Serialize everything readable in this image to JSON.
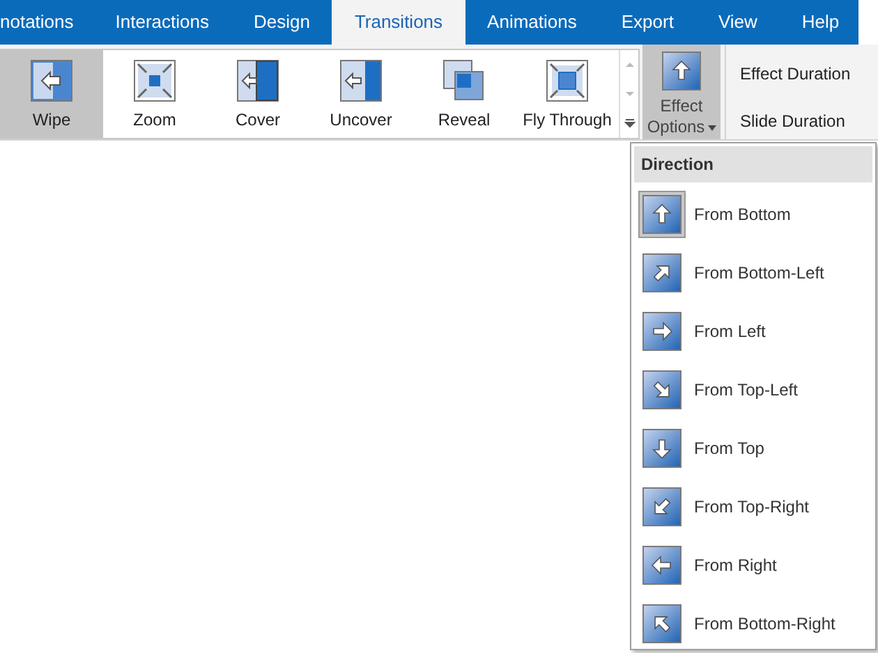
{
  "menu_tabs": [
    {
      "label": "notations",
      "selected": false
    },
    {
      "label": "Interactions",
      "selected": false
    },
    {
      "label": "Design",
      "selected": false
    },
    {
      "label": "Transitions",
      "selected": true
    },
    {
      "label": "Animations",
      "selected": false
    },
    {
      "label": "Export",
      "selected": false
    },
    {
      "label": "View",
      "selected": false
    },
    {
      "label": "Help",
      "selected": false
    }
  ],
  "transitions": [
    {
      "label": "Wipe",
      "kind": "wipe",
      "selected": true
    },
    {
      "label": "Zoom",
      "kind": "zoom",
      "selected": false
    },
    {
      "label": "Cover",
      "kind": "cover",
      "selected": false
    },
    {
      "label": "Uncover",
      "kind": "uncover",
      "selected": false
    },
    {
      "label": "Reveal",
      "kind": "reveal",
      "selected": false
    },
    {
      "label": "Fly Through",
      "kind": "fly",
      "selected": false
    }
  ],
  "effect_options": {
    "label_line_1": "Effect",
    "label_line_2": "Options",
    "expanded": true
  },
  "timing": [
    "Effect Duration",
    "Slide Duration"
  ],
  "direction_menu": {
    "title": "Direction",
    "items": [
      {
        "label": "From Bottom",
        "kind": "up",
        "selected": true
      },
      {
        "label": "From Bottom-Left",
        "kind": "up-right",
        "selected": false
      },
      {
        "label": "From Left",
        "kind": "right",
        "selected": false
      },
      {
        "label": "From Top-Left",
        "kind": "down-right",
        "selected": false
      },
      {
        "label": "From Top",
        "kind": "down",
        "selected": false
      },
      {
        "label": "From Top-Right",
        "kind": "down-left",
        "selected": false
      },
      {
        "label": "From Right",
        "kind": "left",
        "selected": false
      },
      {
        "label": "From Bottom-Right",
        "kind": "up-left",
        "selected": false
      }
    ]
  }
}
